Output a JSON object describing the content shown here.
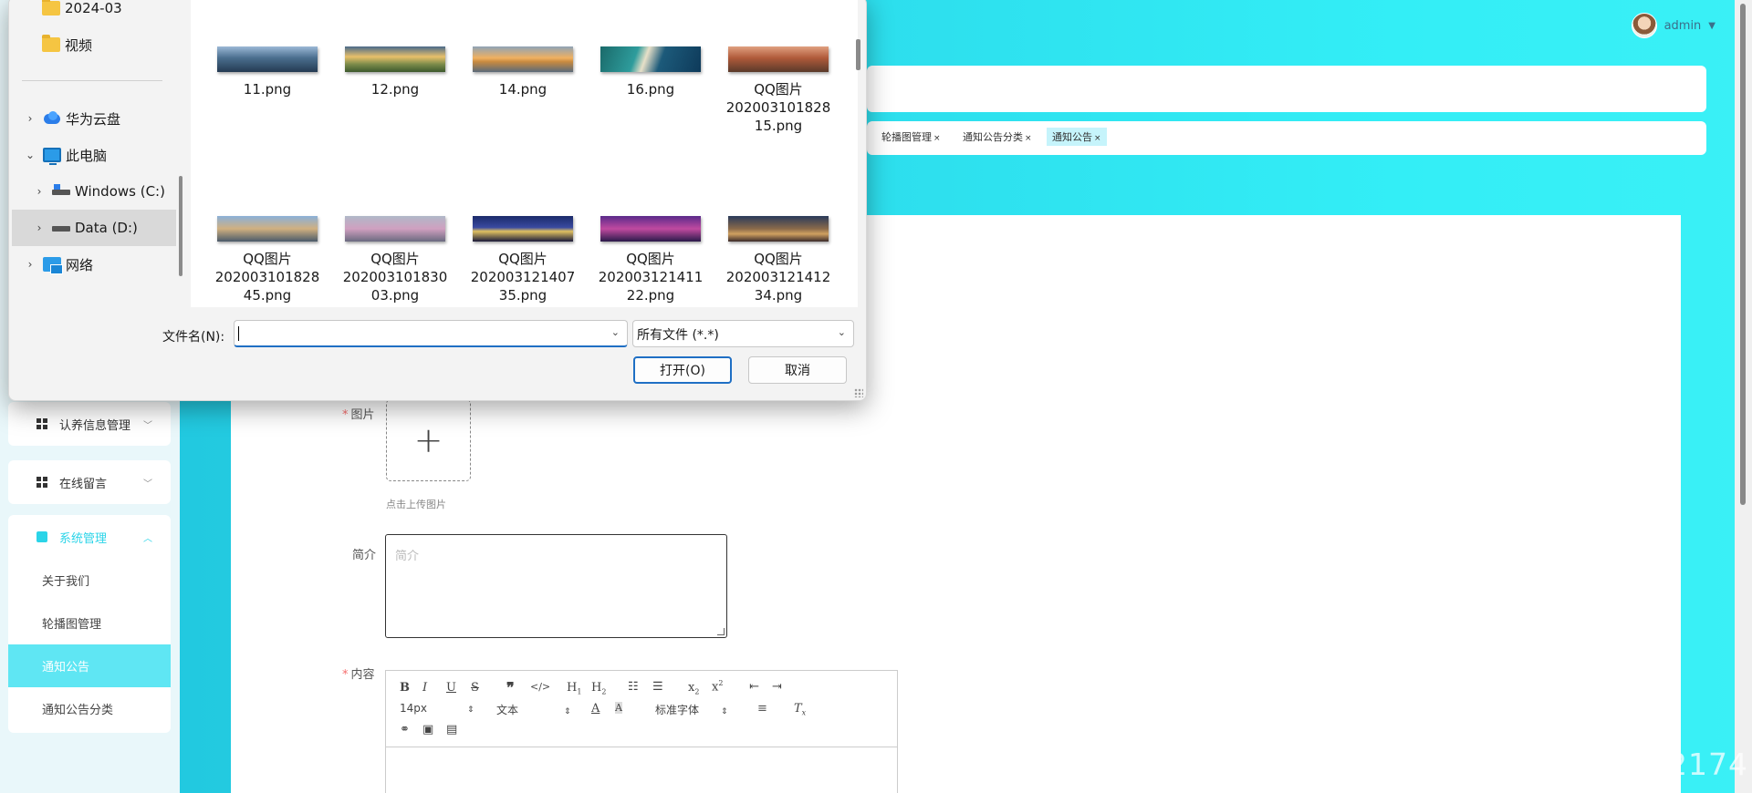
{
  "header": {
    "username": "admin"
  },
  "tabs": [
    {
      "label": "轮播图管理"
    },
    {
      "label": "通知公告分类"
    },
    {
      "label": "通知公告"
    }
  ],
  "sidebar": {
    "groups": [
      {
        "label": "认养信息管理"
      },
      {
        "label": "在线留言"
      },
      {
        "label": "系统管理",
        "subitems": [
          "关于我们",
          "轮播图管理",
          "通知公告",
          "通知公告分类"
        ]
      }
    ]
  },
  "form": {
    "image_label": "图片",
    "upload_hint": "点击上传图片",
    "summary_label": "简介",
    "summary_placeholder": "简介",
    "content_label": "内容",
    "required_mark": "*"
  },
  "editor": {
    "font_size": "14px",
    "paragraph": "文本",
    "font_family": "标准字体"
  },
  "watermark": "CSDN @QQ3359892174",
  "dialog": {
    "nav": [
      {
        "label": "2024-03",
        "icon": "folder-icon"
      },
      {
        "label": "视频",
        "icon": "folder-icon"
      },
      {
        "label": "华为云盘",
        "icon": "cloud-icon"
      },
      {
        "label": "此电脑",
        "icon": "pc-icon"
      },
      {
        "label": "Windows (C:)",
        "icon": "drive-icon"
      },
      {
        "label": "Data (D:)",
        "icon": "drive-icon"
      },
      {
        "label": "网络",
        "icon": "network-icon"
      }
    ],
    "files": [
      {
        "name": "11.png"
      },
      {
        "name": "12.png"
      },
      {
        "name": "14.png"
      },
      {
        "name": "16.png"
      },
      {
        "name": "QQ图片\n20200310182815.png",
        "lines": [
          "QQ图片",
          "202003101828",
          "15.png"
        ]
      },
      {
        "lines": [
          "QQ图片",
          "202003101828",
          "45.png"
        ]
      },
      {
        "lines": [
          "QQ图片",
          "202003101830",
          "03.png"
        ]
      },
      {
        "lines": [
          "QQ图片",
          "202003121407",
          "35.png"
        ]
      },
      {
        "lines": [
          "QQ图片",
          "202003121411",
          "22.png"
        ]
      },
      {
        "lines": [
          "QQ图片",
          "202003121412",
          "34.png"
        ]
      }
    ],
    "filename_label": "文件名(N):",
    "filename_value": "",
    "filetype": "所有文件 (*.*)",
    "open_label": "打开(O)",
    "cancel_label": "取消"
  },
  "colors": {
    "accent": "#2bd4e8",
    "dialog_primary": "#1f6fc4"
  }
}
